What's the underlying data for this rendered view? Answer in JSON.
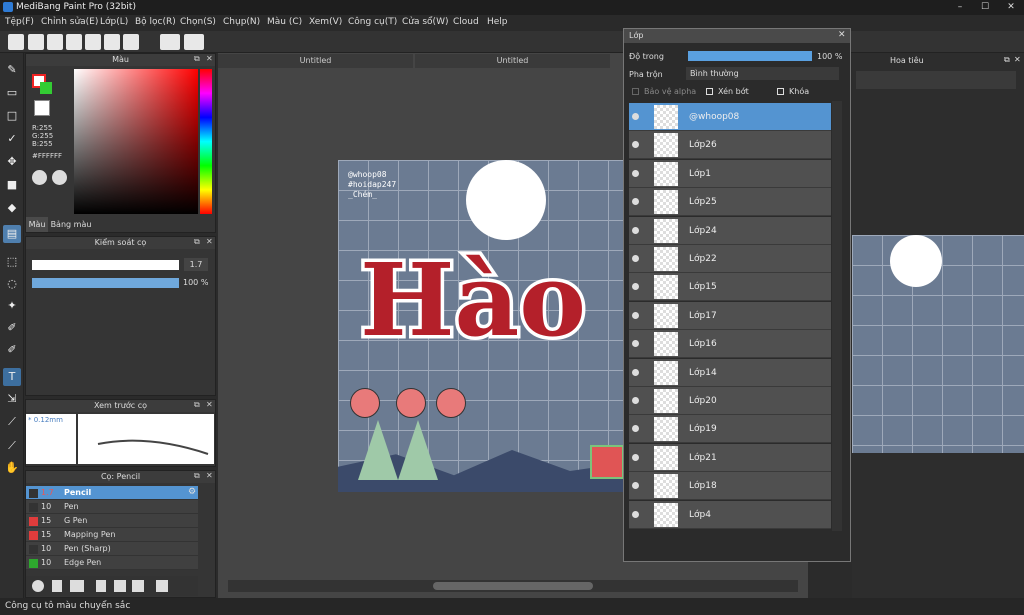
{
  "window": {
    "title": "MediBang Paint Pro (32bit)"
  },
  "menu": [
    "Tệp(F)",
    "Chỉnh sửa(E)",
    "Lớp(L)",
    "Bộ lọc(R)",
    "Chọn(S)",
    "Chụp(N)",
    "Màu (C)",
    "Xem(V)",
    "Công cụ(T)",
    "Cửa sổ(W)",
    "Cloud",
    "Help"
  ],
  "color_panel": {
    "title": "Màu",
    "r": "R:255",
    "g": "G:255",
    "b": "B:255",
    "hex": "#FFFFFF",
    "tab_color": "Màu",
    "tab_palette": "Bảng màu"
  },
  "brush_control": {
    "title": "Kiểm soát cọ",
    "size": "1.7",
    "opacity": "100 %"
  },
  "brush_preview": {
    "title": "Xem trước cọ",
    "size_label": "* 0.12mm"
  },
  "brush_list": {
    "title": "Cọ: Pencil",
    "items": [
      {
        "size": "1.7",
        "name": "Pencil",
        "color": "#333333"
      },
      {
        "size": "10",
        "name": "Pen",
        "color": "#333333"
      },
      {
        "size": "15",
        "name": "G Pen",
        "color": "#e03c3c"
      },
      {
        "size": "15",
        "name": "Mapping Pen",
        "color": "#e03c3c"
      },
      {
        "size": "10",
        "name": "Pen (Sharp)",
        "color": "#333333"
      },
      {
        "size": "10",
        "name": "Edge Pen",
        "color": "#2ea82e"
      }
    ]
  },
  "tabs": [
    "Untitled",
    "Untitled"
  ],
  "artwork": {
    "watermark1": "@whoop08",
    "watermark2": "#hoidap247",
    "watermark3": "_Chém_",
    "headline": "Hào"
  },
  "layers": {
    "title": "Lớp",
    "opacity_label": "Độ trong",
    "opacity_value": "100 %",
    "blend_label": "Pha trộn",
    "blend_value": "Bình thường",
    "protect_alpha": "Bảo vệ alpha",
    "clip": "Xén bớt",
    "lock": "Khóa",
    "items": [
      "@whoop08",
      "Lớp26",
      "Lớp1",
      "Lớp25",
      "Lớp24",
      "Lớp22",
      "Lớp15",
      "Lớp17",
      "Lớp16",
      "Lớp14",
      "Lớp20",
      "Lớp19",
      "Lớp21",
      "Lớp18",
      "Lớp4"
    ]
  },
  "navigator": {
    "title": "Hoa tiêu"
  },
  "status": {
    "text": "Công cụ tô màu chuyển sắc"
  },
  "colors": {
    "accent": "#5494d1",
    "red": "#b4202a"
  }
}
